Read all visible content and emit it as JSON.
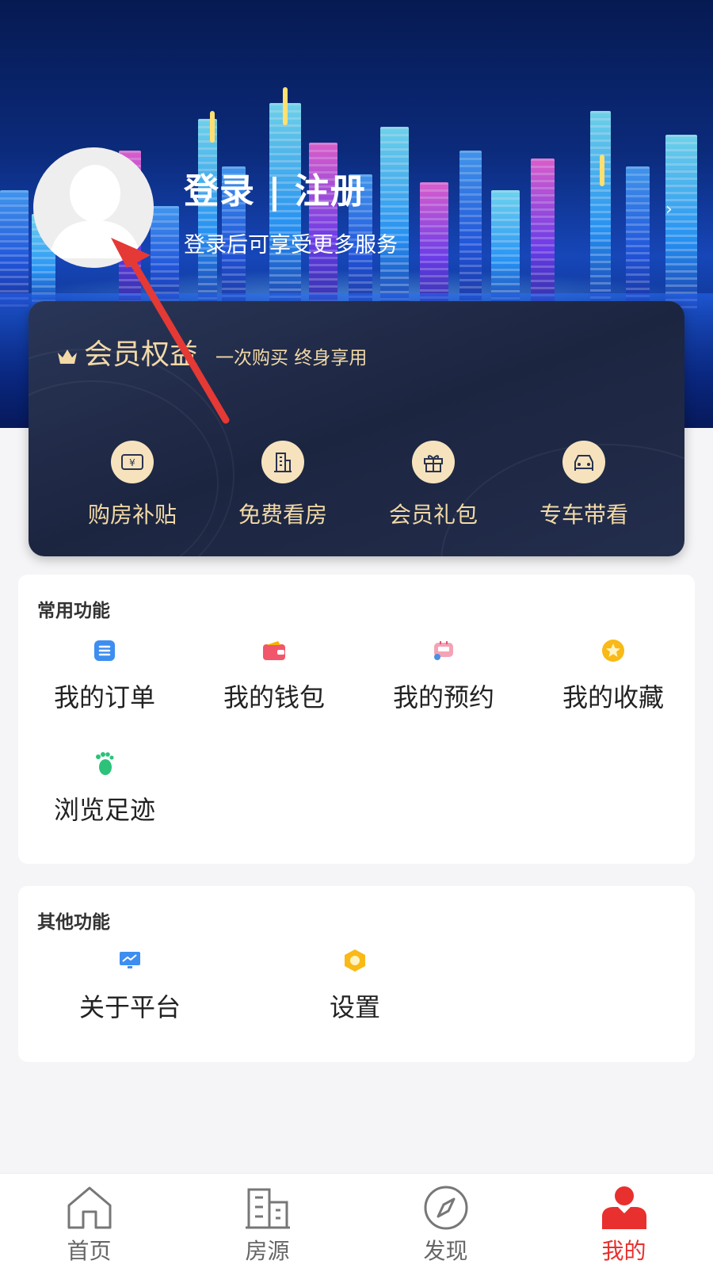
{
  "header": {
    "login_title": "登录 | 注册",
    "login_subtitle": "登录后可享受更多服务"
  },
  "vip": {
    "title": "会员权益",
    "slogan": "一次购买  终身享用",
    "items": [
      {
        "label": "购房补贴",
        "icon": "yuan-ticket-icon"
      },
      {
        "label": "免费看房",
        "icon": "building-icon"
      },
      {
        "label": "会员礼包",
        "icon": "gift-icon"
      },
      {
        "label": "专车带看",
        "icon": "car-icon"
      }
    ]
  },
  "common": {
    "title": "常用功能",
    "items": [
      {
        "label": "我的订单",
        "icon": "order-list-icon"
      },
      {
        "label": "我的钱包",
        "icon": "wallet-icon"
      },
      {
        "label": "我的预约",
        "icon": "appointment-icon"
      },
      {
        "label": "我的收藏",
        "icon": "star-icon"
      },
      {
        "label": "浏览足迹",
        "icon": "footprint-icon"
      }
    ]
  },
  "other": {
    "title": "其他功能",
    "items": [
      {
        "label": "关于平台",
        "icon": "monitor-chart-icon"
      },
      {
        "label": "设置",
        "icon": "hexagon-settings-icon"
      }
    ]
  },
  "tabbar": {
    "items": [
      {
        "label": "首页",
        "icon": "home-icon"
      },
      {
        "label": "房源",
        "icon": "buildings-icon"
      },
      {
        "label": "发现",
        "icon": "compass-icon"
      },
      {
        "label": "我的",
        "icon": "user-icon",
        "active": true
      }
    ]
  },
  "colors": {
    "accent": "#e8302e",
    "gold": "#f2d9a6",
    "card_bg": "#1c2540"
  }
}
